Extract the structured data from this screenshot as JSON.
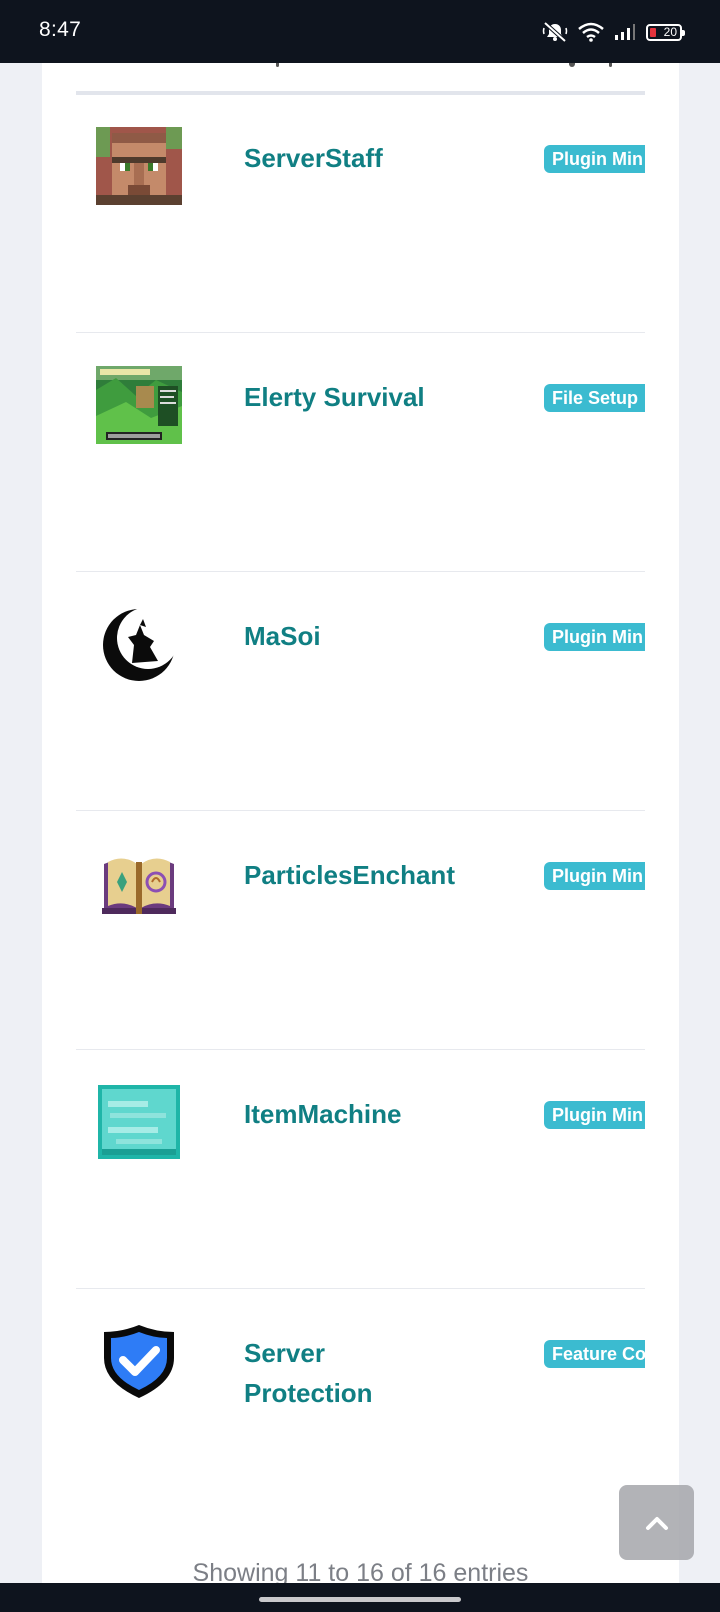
{
  "status_bar": {
    "time": "8:47",
    "battery_level": "20",
    "icons": [
      "mute-icon",
      "wifi-icon",
      "signal-icon",
      "battery-icon"
    ]
  },
  "plugins": [
    {
      "name": "ServerStaff",
      "category": "Plugin Min",
      "thumbnail": "villager-face-image"
    },
    {
      "name": "Elerty Survival",
      "category": "File Setup",
      "thumbnail": "survival-server-screenshot"
    },
    {
      "name": "MaSoi",
      "category": "Plugin Min",
      "thumbnail": "wolf-moon-logo"
    },
    {
      "name": "ParticlesEnchant",
      "category": "Plugin Min",
      "thumbnail": "enchanted-book-image"
    },
    {
      "name": "ItemMachine",
      "category": "Plugin Min",
      "thumbnail": "diamond-block-image"
    },
    {
      "name": "Server Protection",
      "category": "Feature Co",
      "thumbnail": "shield-check-image"
    }
  ],
  "footer": {
    "info": "Showing 11 to 16 of 16 entries"
  },
  "colors": {
    "link": "#107f83",
    "badge": "#3bbbd0",
    "status_bar": "#0e141e"
  }
}
